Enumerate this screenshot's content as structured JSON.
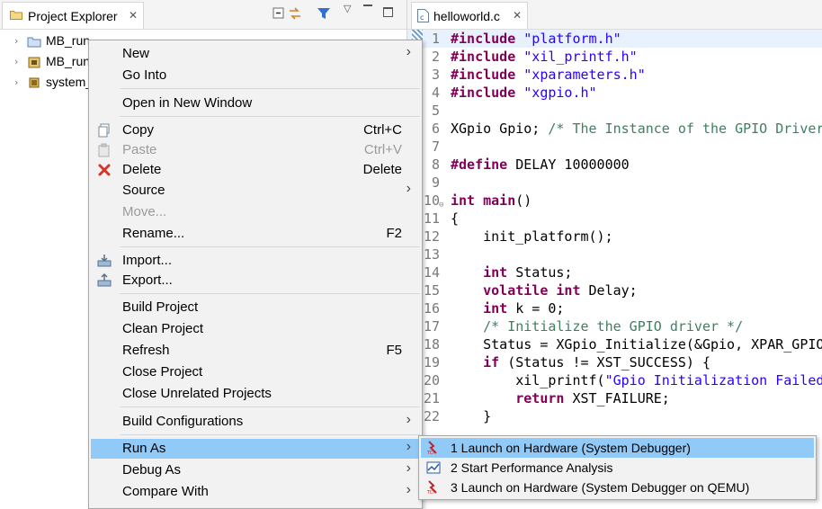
{
  "explorer": {
    "tab_title": "Project Explorer",
    "tree": [
      {
        "label": "MB_run"
      },
      {
        "label": "MB_run"
      },
      {
        "label": "system_"
      }
    ]
  },
  "editor": {
    "tab_title": "helloworld.c",
    "lines": [
      {
        "num": "1",
        "segments": [
          {
            "t": "#include",
            "c": "kw"
          },
          {
            "t": " "
          },
          {
            "t": "\"platform.h\"",
            "c": "str"
          }
        ]
      },
      {
        "num": "2",
        "segments": [
          {
            "t": "#include",
            "c": "kw"
          },
          {
            "t": " "
          },
          {
            "t": "\"xil_printf.h\"",
            "c": "str"
          }
        ]
      },
      {
        "num": "3",
        "segments": [
          {
            "t": "#include",
            "c": "kw"
          },
          {
            "t": " "
          },
          {
            "t": "\"xparameters.h\"",
            "c": "str"
          }
        ]
      },
      {
        "num": "4",
        "segments": [
          {
            "t": "#include",
            "c": "kw"
          },
          {
            "t": " "
          },
          {
            "t": "\"xgpio.h\"",
            "c": "str"
          }
        ]
      },
      {
        "num": "5",
        "segments": []
      },
      {
        "num": "6",
        "segments": [
          {
            "t": "XGpio Gpio; "
          },
          {
            "t": "/* The Instance of the GPIO Driver",
            "c": "cmt"
          }
        ]
      },
      {
        "num": "7",
        "segments": []
      },
      {
        "num": "8",
        "segments": [
          {
            "t": "#define",
            "c": "kw"
          },
          {
            "t": " DELAY 10000000"
          }
        ]
      },
      {
        "num": "9",
        "segments": []
      },
      {
        "num": "10",
        "segments": [
          {
            "t": "int",
            "c": "kw"
          },
          {
            "t": " "
          },
          {
            "t": "main",
            "c": "kw"
          },
          {
            "t": "()"
          }
        ]
      },
      {
        "num": "11",
        "segments": [
          {
            "t": "{"
          }
        ]
      },
      {
        "num": "12",
        "segments": [
          {
            "t": "    init_platform();"
          }
        ]
      },
      {
        "num": "13",
        "segments": []
      },
      {
        "num": "14",
        "segments": [
          {
            "t": "    "
          },
          {
            "t": "int",
            "c": "kw"
          },
          {
            "t": " Status;"
          }
        ]
      },
      {
        "num": "15",
        "segments": [
          {
            "t": "    "
          },
          {
            "t": "volatile",
            "c": "kw"
          },
          {
            "t": " "
          },
          {
            "t": "int",
            "c": "kw"
          },
          {
            "t": " Delay;"
          }
        ]
      },
      {
        "num": "16",
        "segments": [
          {
            "t": "    "
          },
          {
            "t": "int",
            "c": "kw"
          },
          {
            "t": " k = 0;"
          }
        ]
      },
      {
        "num": "17",
        "segments": [
          {
            "t": "    "
          },
          {
            "t": "/* Initialize the GPIO driver */",
            "c": "cmt"
          }
        ]
      },
      {
        "num": "18",
        "segments": [
          {
            "t": "    Status = XGpio_Initialize(&Gpio, XPAR_GPIO"
          }
        ]
      },
      {
        "num": "19",
        "segments": [
          {
            "t": "    "
          },
          {
            "t": "if",
            "c": "kw"
          },
          {
            "t": " (Status != XST_SUCCESS) {"
          }
        ]
      },
      {
        "num": "20",
        "segments": [
          {
            "t": "        xil_printf("
          },
          {
            "t": "\"Gpio Initialization Failed",
            "c": "str"
          }
        ]
      },
      {
        "num": "21",
        "segments": [
          {
            "t": "        "
          },
          {
            "t": "return",
            "c": "kw"
          },
          {
            "t": " XST_FAILURE;"
          }
        ]
      },
      {
        "num": "22",
        "segments": [
          {
            "t": "    }"
          }
        ]
      }
    ]
  },
  "context_menu": {
    "new": "New",
    "go_into": "Go Into",
    "open_new_window": "Open in New Window",
    "copy": "Copy",
    "copy_accel": "Ctrl+C",
    "paste": "Paste",
    "paste_accel": "Ctrl+V",
    "delete": "Delete",
    "delete_accel": "Delete",
    "source": "Source",
    "move": "Move...",
    "rename": "Rename...",
    "rename_accel": "F2",
    "import": "Import...",
    "export": "Export...",
    "build_project": "Build Project",
    "clean_project": "Clean Project",
    "refresh": "Refresh",
    "refresh_accel": "F5",
    "close_project": "Close Project",
    "close_unrelated": "Close Unrelated Projects",
    "build_configurations": "Build Configurations",
    "run_as": "Run As",
    "debug_as": "Debug As",
    "compare_with": "Compare With"
  },
  "run_as_submenu": {
    "item1": "1 Launch on Hardware (System Debugger)",
    "item2": "2 Start Performance Analysis",
    "item3": "3 Launch on Hardware (System Debugger on QEMU)"
  },
  "colors": {
    "menu_highlight": "#91c9f7",
    "keyword": "#7f0055",
    "string": "#2a00ff",
    "comment": "#3f7f5f"
  }
}
